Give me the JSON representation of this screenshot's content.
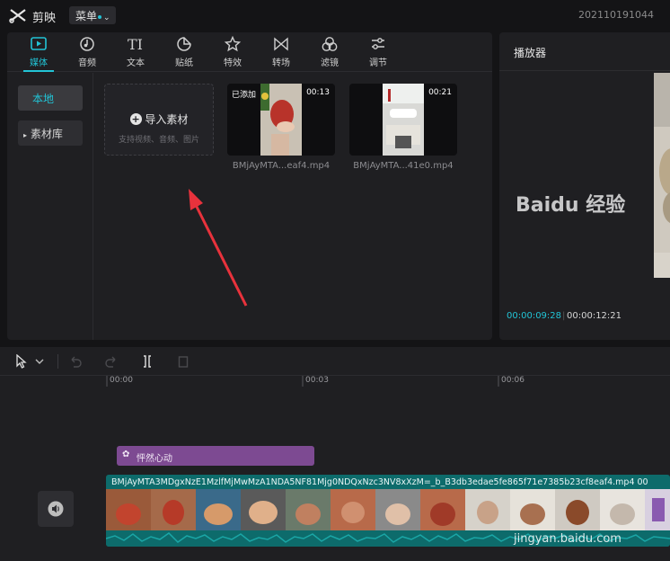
{
  "app": {
    "name": "剪映",
    "menu_label": "菜单",
    "project_id": "202110191044"
  },
  "media_tabs": [
    {
      "label": "媒体",
      "icon": "media-icon",
      "active": true
    },
    {
      "label": "音频",
      "icon": "audio-icon"
    },
    {
      "label": "文本",
      "icon": "text-icon"
    },
    {
      "label": "贴纸",
      "icon": "sticker-icon"
    },
    {
      "label": "特效",
      "icon": "effects-icon"
    },
    {
      "label": "转场",
      "icon": "transition-icon"
    },
    {
      "label": "滤镜",
      "icon": "filter-icon"
    },
    {
      "label": "调节",
      "icon": "adjust-icon"
    }
  ],
  "sidebar": {
    "local": "本地",
    "library": "素材库"
  },
  "import": {
    "label": "导入素材",
    "hint": "支持视频、音频、图片"
  },
  "clips": [
    {
      "badge": "已添加",
      "duration": "00:13",
      "name": "BMjAyMTA...eaf4.mp4"
    },
    {
      "badge": "",
      "duration": "00:21",
      "name": "BMjAyMTA...41e0.mp4"
    }
  ],
  "player": {
    "title": "播放器",
    "current_time": "00:00:09:28",
    "total_time": "00:00:12:21"
  },
  "timeline": {
    "ticks": [
      "00:00",
      "00:03",
      "00:06"
    ],
    "text_track": "怦然心动",
    "video_track_name": "BMjAyMTA3MDgxNzE1MzlfMjMwMzA1NDA5NF81Mjg0NDQxNzc3NV8xXzM=_b_B3db3edae5fe865f71e7385b23cf8eaf4.mp4  00"
  },
  "watermark": {
    "brand": "Baidu 经验",
    "url": "jingyan.baidu.com"
  },
  "colors": {
    "accent": "#22c4d6",
    "text_track": "#7d4a92",
    "video_track": "#0d6b6b",
    "arrow": "#e8323c"
  }
}
